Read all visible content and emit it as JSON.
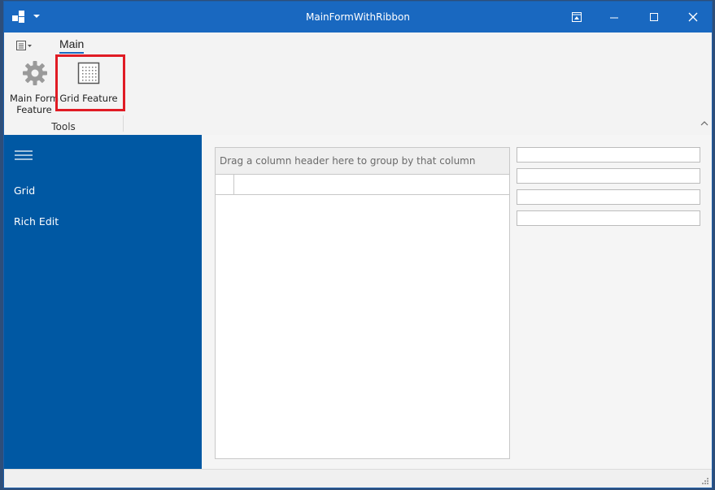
{
  "window": {
    "title": "MainFormWithRibbon"
  },
  "ribbon": {
    "tabs": [
      {
        "label": "Main"
      }
    ],
    "groups": [
      {
        "label": "Tools",
        "buttons": [
          {
            "label_line1": "Main Form",
            "label_line2": "Feature",
            "icon": "gear-icon"
          },
          {
            "label": "Grid Feature",
            "icon": "grid-icon"
          }
        ]
      }
    ]
  },
  "sidebar": {
    "items": [
      {
        "label": "Grid"
      },
      {
        "label": "Rich Edit"
      }
    ]
  },
  "grid": {
    "group_panel_text": "Drag a column header here to group by that column"
  },
  "colors": {
    "accent": "#1968c0",
    "sidebar": "#0058a3",
    "highlight": "#e01b24"
  }
}
